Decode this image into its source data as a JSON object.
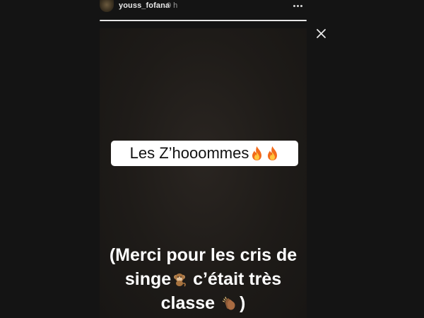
{
  "header": {
    "username": "youss_fofana",
    "time": "9 h",
    "progress": 1.0
  },
  "story": {
    "caption": "Les Z’hooommes",
    "caption_emojis": [
      "fire-icon",
      "fire-icon"
    ],
    "message": {
      "line1": "(Merci pour les cris de",
      "line2_before": "singe",
      "line2_after": " c’était très",
      "line3_before": "classe ",
      "line3_after": ")"
    }
  },
  "colors": {
    "background": "#141414",
    "story_background": "#1e1b18",
    "caption_box": "#ffffff",
    "progress": "#e6e6e6"
  }
}
